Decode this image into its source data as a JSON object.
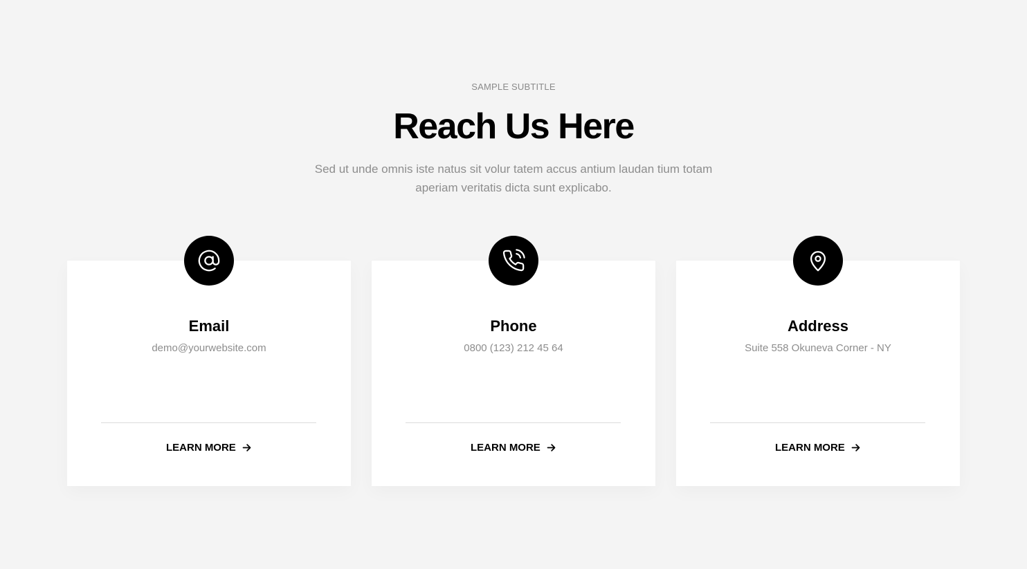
{
  "section": {
    "subtitle": "SAMPLE SUBTITLE",
    "title": "Reach Us Here",
    "description": "Sed ut unde omnis iste natus sit volur tatem accus antium laudan tium totam aperiam veritatis dicta sunt explicabo."
  },
  "cards": [
    {
      "icon": "at-sign-icon",
      "title": "Email",
      "text": "demo@yourwebsite.com",
      "link_label": "LEARN MORE"
    },
    {
      "icon": "phone-call-icon",
      "title": "Phone",
      "text": "0800 (123) 212 45 64",
      "link_label": "LEARN MORE"
    },
    {
      "icon": "location-pin-icon",
      "title": "Address",
      "text": "Suite 558 Okuneva Corner - NY",
      "link_label": "LEARN MORE"
    }
  ],
  "colors": {
    "background": "#f4f4f4",
    "card_background": "#ffffff",
    "icon_background": "#000000",
    "muted_text": "#8d8d8d",
    "heading_text": "#000000"
  }
}
